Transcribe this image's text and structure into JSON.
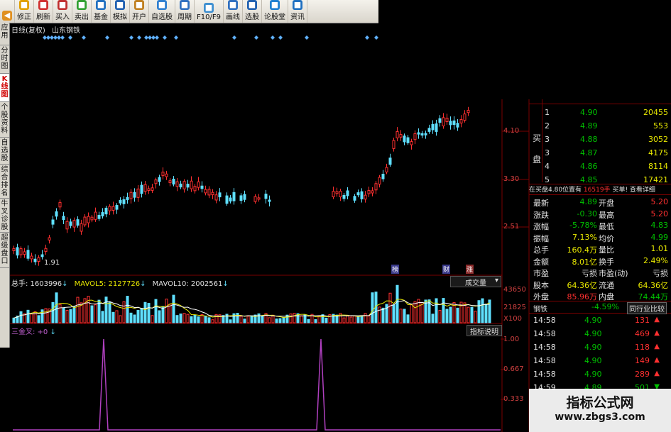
{
  "toolbar": {
    "buttons": [
      {
        "label": "",
        "icon": "back-icon"
      },
      {
        "label": "修正",
        "icon": "correct-icon"
      },
      {
        "label": "刷新",
        "icon": "refresh-icon"
      },
      {
        "label": "买入",
        "icon": "buy-icon"
      },
      {
        "label": "卖出",
        "icon": "sell-icon"
      },
      {
        "label": "基金",
        "icon": "fund-icon"
      },
      {
        "label": "模拟",
        "icon": "simulate-icon"
      },
      {
        "label": "开户",
        "icon": "account-icon"
      },
      {
        "label": "自选股",
        "icon": "watchlist-icon"
      },
      {
        "label": "周期",
        "icon": "period-icon"
      },
      {
        "label": "F10/F9",
        "icon": "f10-icon"
      },
      {
        "label": "画线",
        "icon": "draw-icon"
      },
      {
        "label": "选股",
        "icon": "select-icon"
      },
      {
        "label": "论股堂",
        "icon": "forum-icon"
      },
      {
        "label": "资讯",
        "icon": "news-icon"
      }
    ]
  },
  "sidenav": {
    "tabs": [
      {
        "label": "应用"
      },
      {
        "label": "分时图"
      },
      {
        "label": "K线图",
        "active": true
      },
      {
        "label": "个股资料"
      },
      {
        "label": "自选股"
      },
      {
        "label": "综合排名"
      },
      {
        "label": "牛叉诊股"
      },
      {
        "label": "超级盘口"
      }
    ]
  },
  "chart_header": {
    "period": "日线(复权)",
    "stock": "山东钢铁"
  },
  "price_axis": {
    "labels": [
      "4.10",
      "3.30",
      "2.51"
    ],
    "low_marker": "1.91"
  },
  "event_markers": [
    "榜",
    "财",
    "涨"
  ],
  "volume_header": {
    "total": "总手: 1603996",
    "mavol5": "MAVOL5: 2127726",
    "mavol10": "MAVOL10: 2002561",
    "dropdown": "成交量"
  },
  "volume_axis": {
    "labels": [
      "43650",
      "21825",
      "X100"
    ]
  },
  "indicator": {
    "name": "三金叉: +0",
    "button": "指标说明",
    "axis": [
      "1.00",
      "0.667",
      "0.333"
    ]
  },
  "quote": {
    "buy_title": [
      "买",
      "盘"
    ],
    "buy_levels": [
      {
        "level": "1",
        "price": "4.90",
        "volume": "20455"
      },
      {
        "level": "2",
        "price": "4.89",
        "volume": "553"
      },
      {
        "level": "3",
        "price": "4.88",
        "volume": "3052"
      },
      {
        "level": "3",
        "price": "4.87",
        "volume": "4175"
      },
      {
        "level": "4",
        "price": "4.86",
        "volume": "8114"
      },
      {
        "level": "5",
        "price": "4.85",
        "volume": "17421"
      }
    ],
    "position_text": "在买盘4.80位置有",
    "position_vol": "16519手",
    "position_link": "买单! 查看详细",
    "stats": [
      {
        "k1": "最新",
        "v1": "4.89",
        "c1": "green",
        "k2": "开盘",
        "v2": "5.20",
        "c2": "red"
      },
      {
        "k1": "涨跌",
        "v1": "-0.30",
        "c1": "green",
        "k2": "最高",
        "v2": "5.20",
        "c2": "red"
      },
      {
        "k1": "涨幅",
        "v1": "-5.78%",
        "c1": "green",
        "k2": "最低",
        "v2": "4.83",
        "c2": "green"
      },
      {
        "k1": "振幅",
        "v1": "7.13%",
        "c1": "yellow",
        "k2": "均价",
        "v2": "4.99",
        "c2": "green"
      },
      {
        "k1": "总手",
        "v1": "160.4万",
        "c1": "yellow",
        "k2": "量比",
        "v2": "1.01",
        "c2": "yellow"
      },
      {
        "k1": "金额",
        "v1": "8.01亿",
        "c1": "yellow",
        "k2": "换手",
        "v2": "2.49%",
        "c2": "yellow"
      },
      {
        "k1": "市盈",
        "v1": "亏损",
        "c1": "white",
        "k2": "市盈(动)",
        "v2": "亏损",
        "c2": "white"
      },
      {
        "k1": "股本",
        "v1": "64.36亿",
        "c1": "yellow",
        "k2": "流通",
        "v2": "64.36亿",
        "c2": "yellow"
      },
      {
        "k1": "外盘",
        "v1": "85.96万",
        "c1": "red",
        "k2": "内盘",
        "v2": "74.44万",
        "c2": "green"
      }
    ],
    "sector_name": "钢铁",
    "sector_change": "-4.59%",
    "sector_button": "同行业比较",
    "ticks": [
      {
        "time": "14:58",
        "price": "4.90",
        "vol": "131",
        "dir": "up"
      },
      {
        "time": "14:58",
        "price": "4.90",
        "vol": "469",
        "dir": "up"
      },
      {
        "time": "14:58",
        "price": "4.90",
        "vol": "118",
        "dir": "up"
      },
      {
        "time": "14:58",
        "price": "4.90",
        "vol": "149",
        "dir": "up"
      },
      {
        "time": "14:58",
        "price": "4.90",
        "vol": "289",
        "dir": "up"
      },
      {
        "time": "14:59",
        "price": "4.89",
        "vol": "501",
        "dir": "down"
      }
    ]
  },
  "watermark": {
    "title": "指标公式网",
    "url": "www.zbgs3.com"
  },
  "colors": {
    "up": "#ff3030",
    "down": "#5fe0ff",
    "purple": "#b040c0",
    "grid": "#7a0000"
  }
}
